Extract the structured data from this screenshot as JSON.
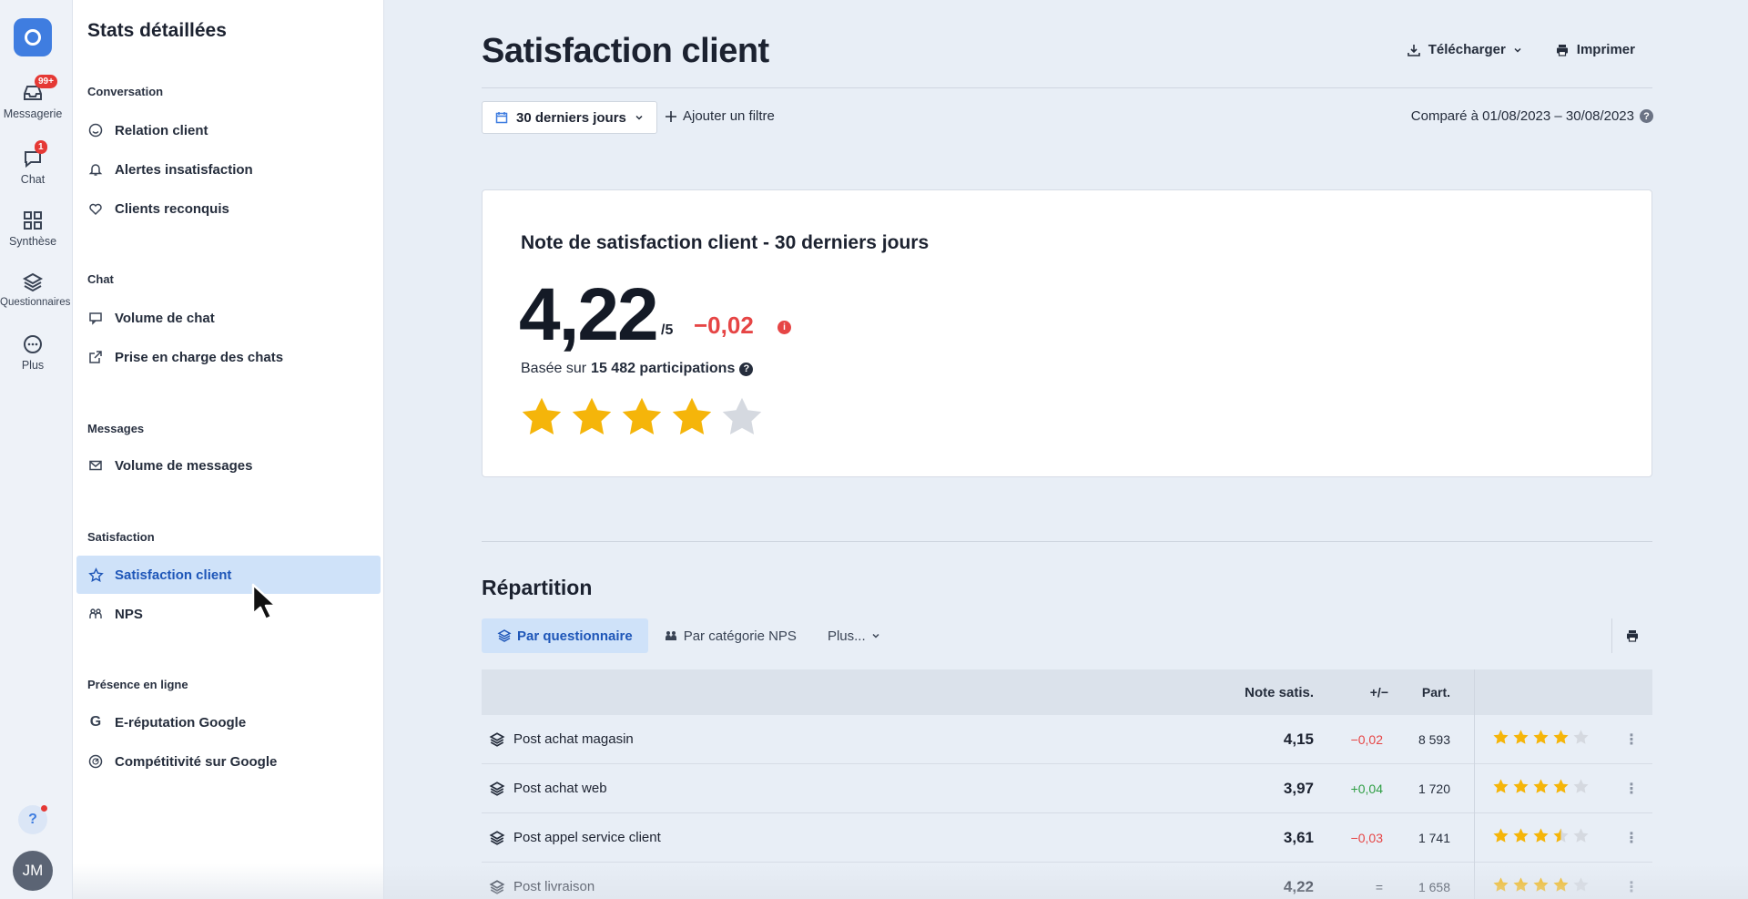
{
  "rail": {
    "items": [
      {
        "label": "Messagerie",
        "badge": "99+",
        "icon": "inbox-icon"
      },
      {
        "label": "Chat",
        "badge": "1",
        "icon": "chat-bubble-icon"
      },
      {
        "label": "Synthèse",
        "badge": "",
        "icon": "grid-icon"
      },
      {
        "label": "Questionnaires",
        "badge": "",
        "icon": "layers-icon"
      },
      {
        "label": "Plus",
        "badge": "",
        "icon": "more-dots-icon"
      }
    ],
    "avatar": "JM"
  },
  "sidebar": {
    "title": "Stats détaillées",
    "sections": [
      {
        "label": "Conversation",
        "items": [
          "Relation client",
          "Alertes insatisfaction",
          "Clients reconquis"
        ]
      },
      {
        "label": "Chat",
        "items": [
          "Volume de chat",
          "Prise en charge des chats"
        ]
      },
      {
        "label": "Messages",
        "items": [
          "Volume de messages"
        ]
      },
      {
        "label": "Satisfaction",
        "items": [
          "Satisfaction client",
          "NPS"
        ]
      },
      {
        "label": "Présence en ligne",
        "items": [
          "E-réputation Google",
          "Compétitivité sur Google"
        ]
      }
    ],
    "active_item": "Satisfaction client"
  },
  "header": {
    "title": "Satisfaction client",
    "download_label": "Télécharger",
    "print_label": "Imprimer"
  },
  "filters": {
    "date_range": "30 derniers jours",
    "add_filter": "Ajouter un filtre",
    "compare": "Comparé à 01/08/2023 – 30/08/2023"
  },
  "score_card": {
    "title": "Note de satisfaction client - 30 derniers jours",
    "score": "4,22",
    "max": "/5",
    "delta": "−0,02",
    "based_prefix": "Basée sur",
    "based_count": "15 482 participations",
    "stars_filled": 4,
    "stars_total": 5
  },
  "repartition": {
    "title": "Répartition",
    "tabs": [
      "Par questionnaire",
      "Par catégorie NPS",
      "Plus..."
    ],
    "columns": {
      "note": "Note satis.",
      "diff": "+/−",
      "part": "Part."
    },
    "rows": [
      {
        "name": "Post achat magasin",
        "note": "4,15",
        "diff": "−0,02",
        "diff_type": "neg",
        "part": "8 593",
        "stars": 4
      },
      {
        "name": "Post achat web",
        "note": "3,97",
        "diff": "+0,04",
        "diff_type": "pos",
        "part": "1 720",
        "stars": 4
      },
      {
        "name": "Post appel service client",
        "note": "3,61",
        "diff": "−0,03",
        "diff_type": "neg",
        "part": "1 741",
        "stars": 3.5
      },
      {
        "name": "Post livraison",
        "note": "4,22",
        "diff": "=",
        "diff_type": "eq",
        "part": "1 658",
        "stars": 4
      }
    ]
  },
  "colors": {
    "accent": "#3f7de0",
    "star": "#f5b50a",
    "star_empty": "#d5d9e0",
    "negative": "#e64545",
    "positive": "#2f9e44"
  }
}
